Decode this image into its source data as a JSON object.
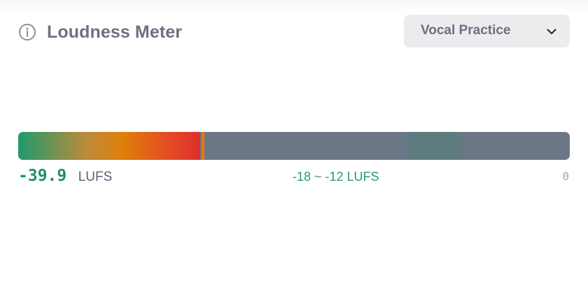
{
  "header": {
    "title": "Loudness Meter",
    "info_icon": "info-circle-icon",
    "preset": {
      "selected": "Vocal Practice",
      "chevron_icon": "chevron-down-icon"
    }
  },
  "meter": {
    "value": "-39.9",
    "unit": "LUFS",
    "level_fraction": 0.33,
    "peak_fraction": 0.335,
    "target_start_fraction": 0.703,
    "target_end_fraction": 0.802,
    "target_label": "-18 ~ -12 LUFS",
    "scale_max": "0",
    "colors": {
      "track": "#6b7786",
      "target_zone": "#5f7c80",
      "value_text": "#1d9267",
      "gradient": [
        "#1f9a6c",
        "#bd8b3a",
        "#e07e0b",
        "#e34d24",
        "#de2f2c"
      ]
    }
  }
}
